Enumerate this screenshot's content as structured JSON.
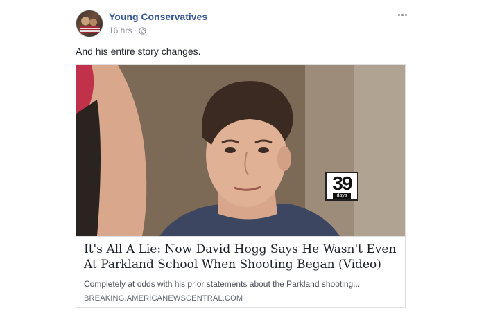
{
  "post": {
    "author": "Young Conservatives",
    "timestamp": "16 hrs",
    "separator": "·",
    "privacy_icon": "globe-icon",
    "menu_icon": "more-options-icon",
    "status_text": "And his entire story changes."
  },
  "link_card": {
    "image_badge_number": "39",
    "image_badge_label": "days",
    "headline": "It's All A Lie: Now David Hogg Says He Wasn't Even At Parkland School When Shooting Began (Video)",
    "description": "Completely at odds with his prior statements about the Parkland shooting...",
    "source_domain": "BREAKING.AMERICANEWSCENTRAL.COM"
  },
  "colors": {
    "author_link": "#365899",
    "meta_gray": "#90949c",
    "text": "#1d2129",
    "card_border": "#dddfe2"
  }
}
